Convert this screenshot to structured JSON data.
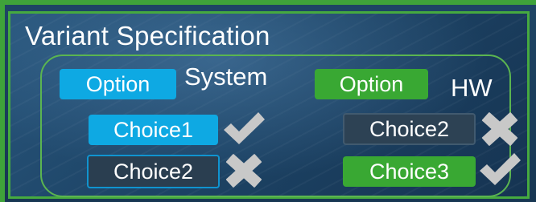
{
  "title": "Variant Specification",
  "system": {
    "option_label": "Option",
    "name": "System",
    "choices": [
      {
        "label": "Choice1",
        "selected": true,
        "status": "check"
      },
      {
        "label": "Choice2",
        "selected": false,
        "status": "cross"
      }
    ]
  },
  "hw": {
    "option_label": "Option",
    "name": "HW",
    "choices": [
      {
        "label": "Choice2",
        "selected": false,
        "status": "cross"
      },
      {
        "label": "Choice3",
        "selected": true,
        "status": "check"
      }
    ]
  },
  "colors": {
    "system_accent": "#0ea9e3",
    "hw_accent": "#39a833",
    "border_green": "#46aa3f",
    "mark_gray": "#c8c8c8"
  },
  "icons": {
    "check": "check-icon",
    "cross": "cross-icon"
  }
}
